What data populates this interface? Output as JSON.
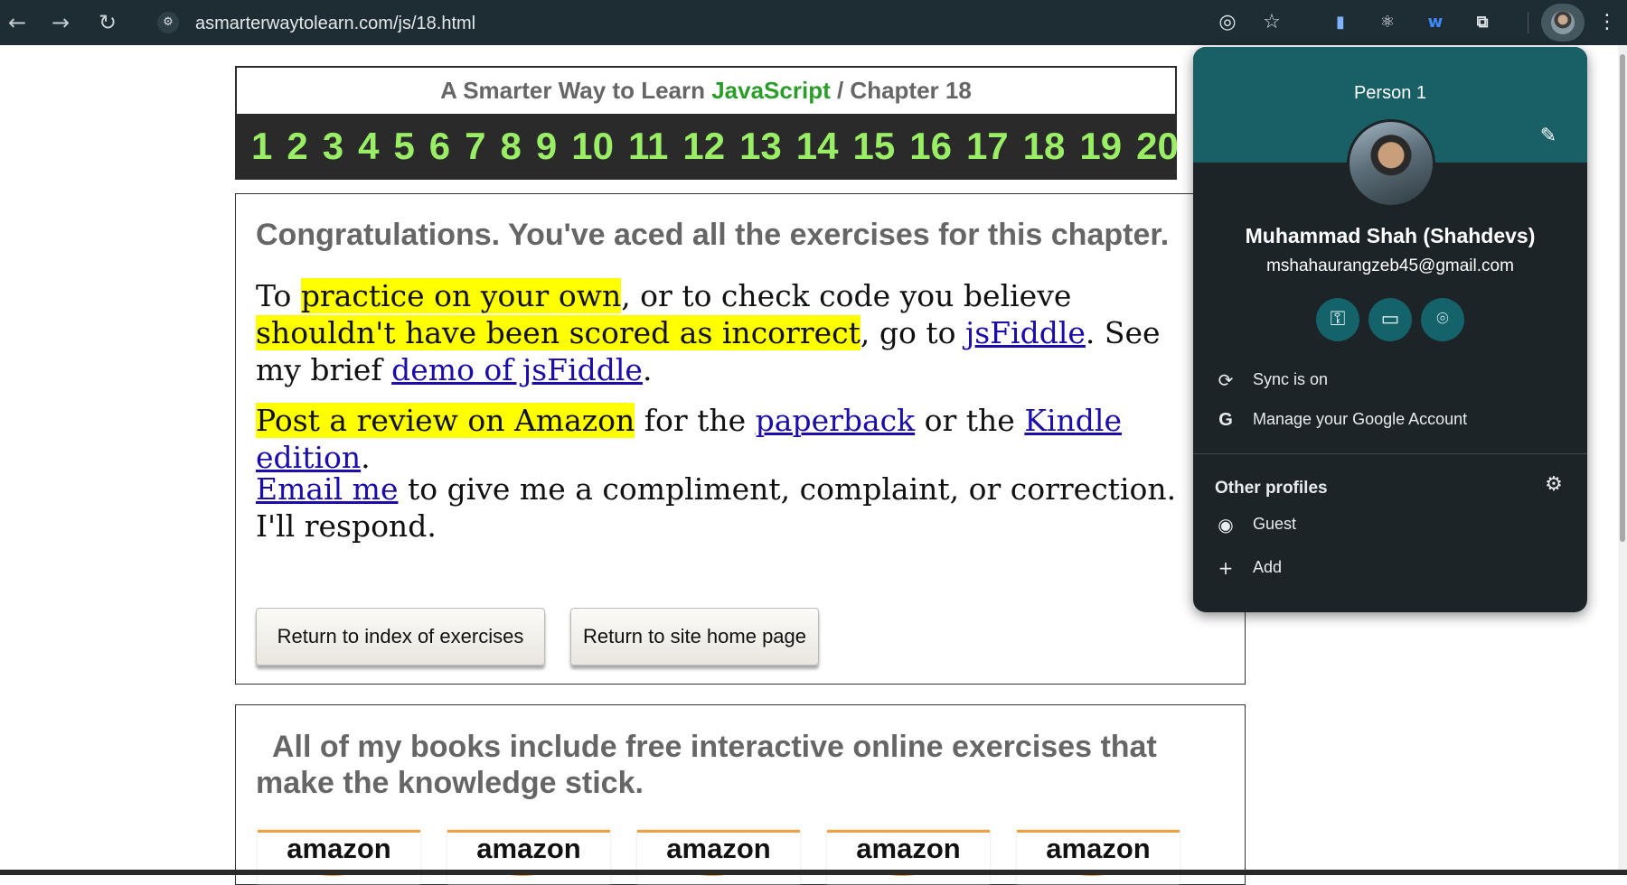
{
  "browser": {
    "url": "asmarterwaytolearn.com/js/18.html",
    "back_icon": "arrow-left-icon",
    "forward_icon": "arrow-right-icon",
    "reload_icon": "reload-icon"
  },
  "header": {
    "title_prefix": "A Smarter Way to Learn ",
    "title_js": "JavaScript",
    "title_suffix": " / Chapter 18",
    "chapters": [
      "1",
      "2",
      "3",
      "4",
      "5",
      "6",
      "7",
      "8",
      "9",
      "10",
      "11",
      "12",
      "13",
      "14",
      "15",
      "16",
      "17",
      "18",
      "19",
      "20"
    ]
  },
  "main": {
    "congrats": "Congratulations. You've aced all the exercises for this chapter.",
    "p1": {
      "t1": "To ",
      "h1": "practice on your own",
      "t2": ", or to check code you believe ",
      "h2": "shouldn't have been scored as incorrect",
      "t3": ", go to ",
      "l1": "jsFiddle",
      "t4": ". See my brief ",
      "l2": "demo of jsFiddle",
      "t5": "."
    },
    "p2": {
      "h1": "Post a review on Amazon",
      "t1": " for the ",
      "l1": "paperback",
      "t2": " or the ",
      "l2": "Kindle edition",
      "t3": "."
    },
    "p3": {
      "l1": "Email me",
      "t1": " to give me a compliment, complaint, or correction. I'll respond."
    },
    "btn_index": "Return to index of exercises",
    "btn_home": "Return to site home page"
  },
  "books": {
    "text": "All of my books include free interactive online exercises that make the knowledge stick.",
    "amazon_label": "amazon"
  },
  "profile_popup": {
    "profile_name": "Person 1",
    "full_name": "Muhammad Shah (Shahdevs)",
    "email": "mshahaurangzeb45@gmail.com",
    "sync": "Sync is on",
    "manage": "Manage your Google Account",
    "other_profiles": "Other profiles",
    "guest": "Guest",
    "add": "Add",
    "accent_color": "#195f66"
  }
}
